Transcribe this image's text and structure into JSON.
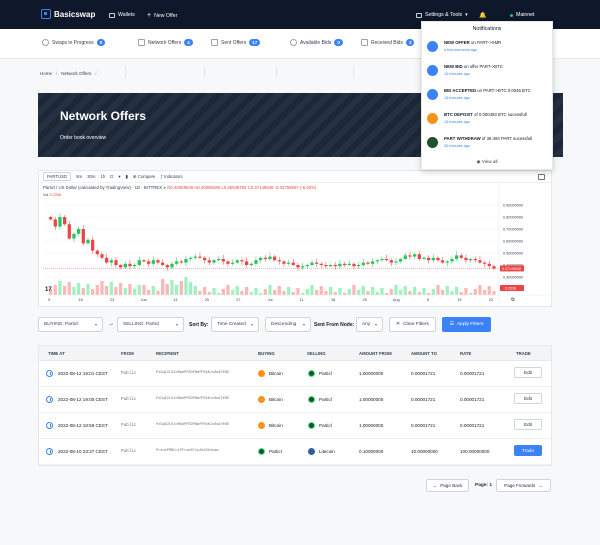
{
  "app": {
    "name": "Basicswap"
  },
  "topnav": {
    "wallets": "Wallets",
    "new_offer": "New Offer",
    "settings": "Settings & Tools",
    "network": "Mainnet"
  },
  "stats": [
    {
      "label": "Swaps in Progress",
      "count": "0"
    },
    {
      "label": "Network Offers",
      "count": "4"
    },
    {
      "label": "Sent Offers",
      "count": "17"
    },
    {
      "label": "Available Bids",
      "count": "0"
    },
    {
      "label": "Received Bids",
      "count": "3"
    }
  ],
  "breadcrumb": {
    "home": "Home",
    "sep": "/",
    "current": "Network Offers",
    "sep2": "/"
  },
  "hero": {
    "title": "Network Offers",
    "subtitle": "Order book overview"
  },
  "chart_toolbar": {
    "symbol": "PARTUSD",
    "intervals": [
      "5m",
      "30m",
      "1h",
      "D"
    ],
    "compare": "Compare",
    "indicators": "Indicators"
  },
  "chart_data": {
    "type": "candlestick",
    "title": "Particl / US Dollar (calculated by TradingView) · 1D · BITTREX",
    "ohlc_text": "O0.40058549 H0.40089280 L0.35048784 C0.37149048 -0.02759697 (-6.92%)",
    "volume_label": "Vol",
    "volume_value": "5.2336",
    "x_ticks": [
      "9",
      "16",
      "23",
      "Jun",
      "13",
      "20",
      "27",
      "Jul",
      "11",
      "18",
      "25",
      "Aug",
      "8",
      "15",
      "22"
    ],
    "y_ticks": [
      "0.90000000",
      "0.80000000",
      "0.70000000",
      "0.60000000",
      "0.50000000",
      "0.40000000",
      "0.30000000"
    ],
    "ylim": [
      0.25,
      0.95
    ],
    "last_price": "0.37149048",
    "last_volume": "5.2336",
    "logo": "17",
    "closes": [
      0.78,
      0.72,
      0.8,
      0.74,
      0.62,
      0.66,
      0.7,
      0.58,
      0.61,
      0.52,
      0.49,
      0.46,
      0.42,
      0.44,
      0.4,
      0.38,
      0.41,
      0.39,
      0.4,
      0.44,
      0.43,
      0.41,
      0.44,
      0.42,
      0.4,
      0.38,
      0.41,
      0.43,
      0.42,
      0.45,
      0.46,
      0.47,
      0.46,
      0.44,
      0.42,
      0.44,
      0.45,
      0.43,
      0.41,
      0.42,
      0.44,
      0.43,
      0.4,
      0.41,
      0.44,
      0.46,
      0.45,
      0.47,
      0.44,
      0.43,
      0.41,
      0.42,
      0.4,
      0.38,
      0.39,
      0.4,
      0.42,
      0.41,
      0.4,
      0.39,
      0.4,
      0.39,
      0.41,
      0.4,
      0.41,
      0.39,
      0.4,
      0.42,
      0.41,
      0.43,
      0.44,
      0.45,
      0.44,
      0.42,
      0.43,
      0.45,
      0.48,
      0.47,
      0.49,
      0.45,
      0.46,
      0.44,
      0.46,
      0.44,
      0.42,
      0.43,
      0.45,
      0.48,
      0.46,
      0.44,
      0.45,
      0.44,
      0.42,
      0.41,
      0.39,
      0.37
    ]
  },
  "filters": {
    "buying_label": "BUYING: Particl",
    "arrow": "→",
    "selling_label": "SELLING: Particl",
    "sort_by_label": "Sort By:",
    "sort_value": "Time Created",
    "order_value": "Descending",
    "sent_from_label": "Sent From Node:",
    "sent_from_value": "Any",
    "clear": "Clear Filters",
    "apply": "Apply Filters"
  },
  "table": {
    "headers": [
      "TIME AT",
      "FROM",
      "RECIPIENT",
      "BUYING",
      "SELLING",
      "AMOUNT FROM",
      "AMOUNT TO",
      "RATE",
      "TRADE"
    ],
    "rows": [
      {
        "time": "2022-08-12 19:01 CEST",
        "from": "Public",
        "recipient": "PzGqE2LSJdRmdPPSDPBmfPRkK1v8mZYE6E",
        "buying": "Bitcoin",
        "buy_coin": "btc",
        "selling": "Particl",
        "sell_coin": "part",
        "amount_from": "1.00000000",
        "amount_to": "0.00001721",
        "rate": "0.00001721",
        "trade": "Edit"
      },
      {
        "time": "2022-08-12 19:00 CEST",
        "from": "Public",
        "recipient": "PzGqE2LSJdRmdPPSDPBmfPRkK1v8mZYE6E",
        "buying": "Bitcoin",
        "buy_coin": "btc",
        "selling": "Particl",
        "sell_coin": "part",
        "amount_from": "1.00000000",
        "amount_to": "0.00001721",
        "rate": "0.00001721",
        "trade": "Edit"
      },
      {
        "time": "2022-08-12 18:59 CEST",
        "from": "Public",
        "recipient": "PzGqE2LSJdRmdPPSDPBmfPRkK1v8mZYE6E",
        "buying": "Bitcoin",
        "buy_coin": "btc",
        "selling": "Particl",
        "sell_coin": "part",
        "amount_from": "1.00000000",
        "amount_to": "0.00001721",
        "rate": "0.00001721",
        "trade": "Edit"
      },
      {
        "time": "2022-08-10 23:37 CEST",
        "from": "Public",
        "recipient": "PrenkPRBLh1PFrwe6Tcc2bK3h4sem",
        "buying": "Particl",
        "buy_coin": "part",
        "selling": "Litecoin",
        "sell_coin": "ltc",
        "amount_from": "0.10000000",
        "amount_to": "10.00000000",
        "rate": "100.00000000",
        "trade": "Trade"
      }
    ]
  },
  "pagination": {
    "prev": "Page Back",
    "page": "Page: 1",
    "next": "Page Forwards"
  },
  "notifications": {
    "title": "Notifications",
    "items": [
      {
        "bold": "NEW OFFER",
        "rest": " on PART->XMR",
        "time": "a few moments ago",
        "color": "#3b82f6"
      },
      {
        "bold": "NEW BID",
        "rest": " on offer PART->BTC",
        "time": "10 minutes ago",
        "color": "#3b82f6"
      },
      {
        "bold": "BID ACCEPTED",
        "rest": " on PART->BTC 0.0045 BTC",
        "time": "15 minutes ago",
        "color": "#3b82f6"
      },
      {
        "bold": "BTC DEPOSIT",
        "rest": " of 0.000493 BTC sucessfull",
        "time": "15 minutes ago",
        "color": "#f7931a"
      },
      {
        "bold": "PART WITHDRAW",
        "rest": " of 39.494 PART sucessfull",
        "time": "30 minutes ago",
        "color": "#1f5130"
      }
    ],
    "view_all": "View all"
  },
  "colors": {
    "accent": "#3b82f6",
    "up": "#22c55e",
    "down": "#ef4444",
    "navbar": "#0f172a"
  }
}
